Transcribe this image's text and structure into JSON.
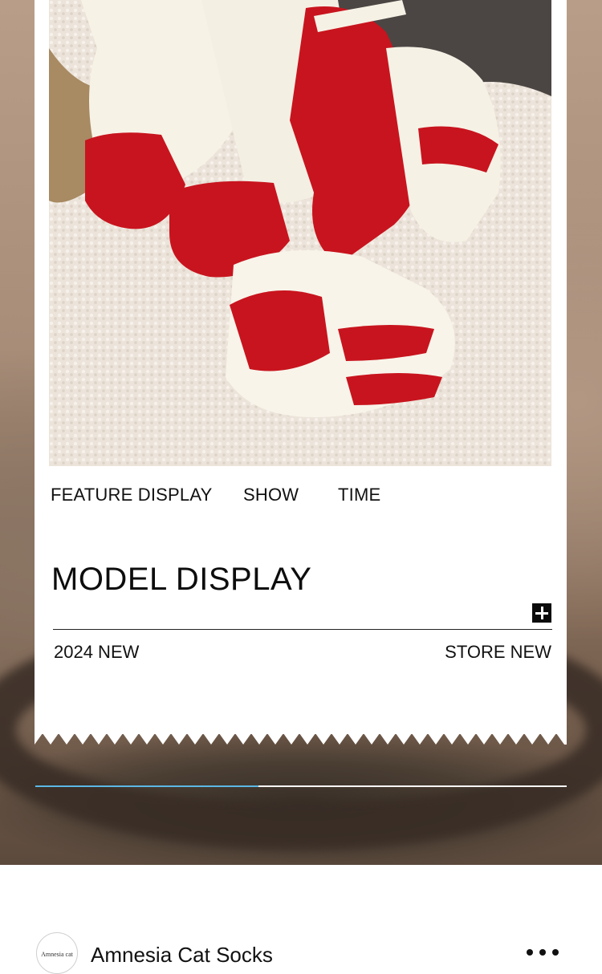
{
  "feature_nav": {
    "items": [
      "FEATURE DISPLAY",
      "SHOW",
      "TIME"
    ]
  },
  "model_section": {
    "title": "MODEL DISPLAY",
    "expand_icon": "plus-icon",
    "left_caption": "2024 NEW",
    "right_caption": "STORE NEW"
  },
  "carousel": {
    "progress_fraction": 0.42,
    "accent_color": "#5bb8e6"
  },
  "store": {
    "avatar_text": "Amnesia cat",
    "name": "Amnesia Cat Socks",
    "more_icon": "more-dots-icon"
  },
  "colors": {
    "sock_red": "#c8141e",
    "sock_cream": "#f7f2e6"
  }
}
